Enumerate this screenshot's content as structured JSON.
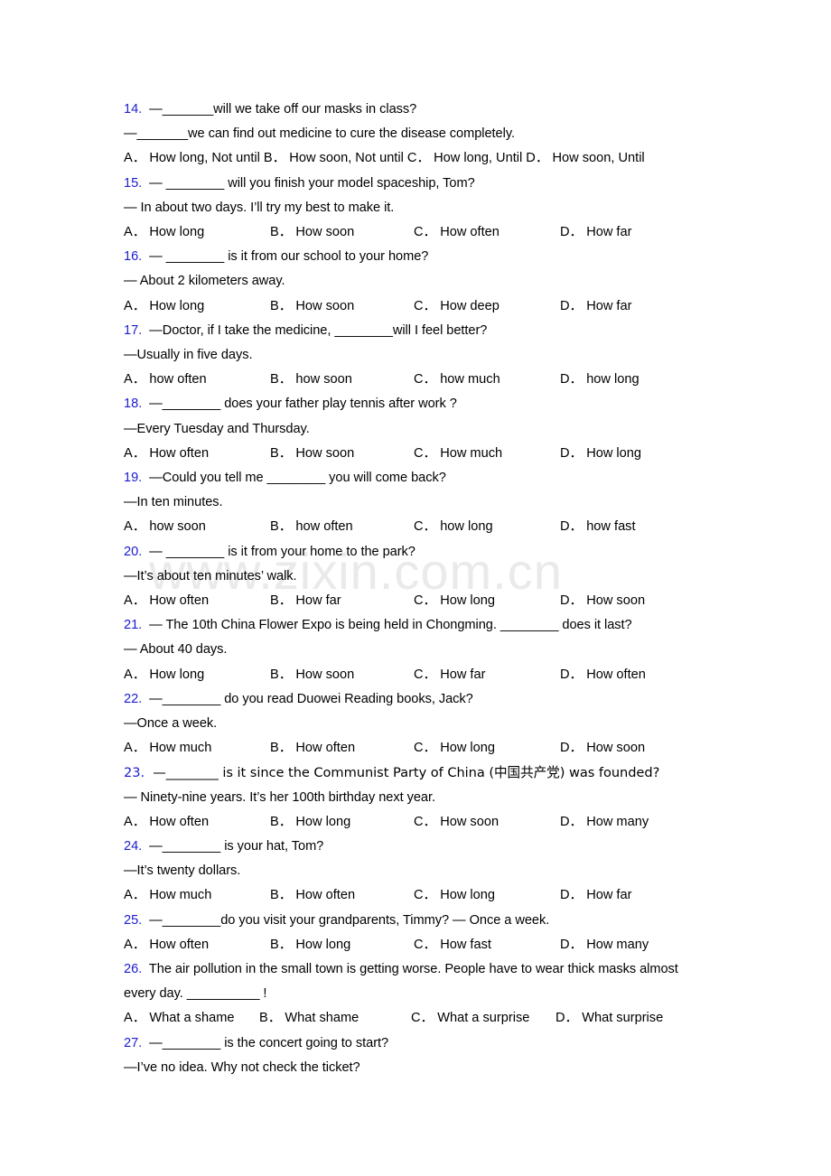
{
  "document": {
    "watermark": "www.zixin.com.cn",
    "accent_number_color": "#1c1cd0",
    "text_color": "#000000",
    "background_color": "#ffffff"
  },
  "questions": [
    {
      "number": "14.",
      "lines": [
        "—_______will we take off our masks in class?",
        "—_______we can find out medicine to cure the disease completely."
      ],
      "options_inline": "A． How long, Not until B． How soon, Not until C． How long, Until      D． How soon, Until",
      "options": [
        "A． How long, Not until",
        "B． How soon, Not until",
        "C． How long, Until",
        "D． How soon, Until"
      ]
    },
    {
      "number": "15.",
      "lines": [
        "— ________ will you finish your model spaceship, Tom?",
        "— In about two days. I’ll try my best to make it."
      ],
      "options": [
        "A． How long",
        "B． How soon",
        "C． How often",
        "D． How far"
      ]
    },
    {
      "number": "16.",
      "lines": [
        "— ________ is it from our school to your home?",
        "— About 2 kilometers away."
      ],
      "options": [
        "A． How long",
        "B． How soon",
        "C． How deep",
        "D． How far"
      ]
    },
    {
      "number": "17.",
      "lines": [
        "—Doctor, if I take the medicine, ________will I feel better?",
        "—Usually in five days."
      ],
      "options": [
        "A． how often",
        "B． how soon",
        "C． how much",
        "D． how long"
      ]
    },
    {
      "number": "18.",
      "lines": [
        "—________ does your father play tennis after work ?",
        "—Every Tuesday and Thursday."
      ],
      "options": [
        "A． How often",
        "B． How soon",
        "C． How much",
        "D． How long"
      ]
    },
    {
      "number": "19.",
      "lines": [
        "—Could you tell me ________ you will come back?",
        "—In ten minutes."
      ],
      "options": [
        "A． how soon",
        "B． how often",
        "C． how long",
        "D． how fast"
      ]
    },
    {
      "number": "20.",
      "lines": [
        "— ________ is it from your home to the park?",
        "—It’s about ten minutes’ walk."
      ],
      "options": [
        "A． How often",
        "B． How far",
        "C． How long",
        "D． How soon"
      ]
    },
    {
      "number": "21.",
      "lines": [
        "— The 10th China Flower Expo is being held in Chongming. ________ does it last?",
        "— About 40 days."
      ],
      "options": [
        "A． How long",
        "B． How soon",
        "C． How far",
        "D． How often"
      ]
    },
    {
      "number": "22.",
      "lines": [
        "—________ do you read Duowei Reading books, Jack?",
        "—Once a week."
      ],
      "options": [
        "A． How much",
        "B． How often",
        "C． How long",
        "D． How soon"
      ]
    },
    {
      "number": "23.",
      "lines": [
        "—________ is it since the Communist Party of China (中国共产党) was founded?",
        "— Ninety-nine years. It’s her 100th birthday next year."
      ],
      "options": [
        "A． How often",
        "B． How long",
        "C． How soon",
        "D． How many"
      ]
    },
    {
      "number": "24.",
      "lines": [
        "—________ is your hat, Tom?",
        "—It’s twenty dollars."
      ],
      "options": [
        "A． How much",
        "B． How often",
        "C． How long",
        "D． How far"
      ]
    },
    {
      "number": "25.",
      "lines": [
        "—________do you visit your grandparents, Timmy? — Once a week."
      ],
      "options": [
        "A． How often",
        "B． How long",
        "C． How fast",
        "D． How many"
      ]
    },
    {
      "number": "26.",
      "lines": [
        "The air pollution in the small town is getting worse. People have to wear thick masks almost",
        "every day. __________ !"
      ],
      "options": [
        "A． What a shame",
        "B． What shame",
        "C． What a surprise",
        "D． What surprise"
      ]
    },
    {
      "number": "27.",
      "lines": [
        "—________ is the concert going to start?",
        "—I’ve no idea. Why not check the ticket?"
      ],
      "options": []
    }
  ]
}
